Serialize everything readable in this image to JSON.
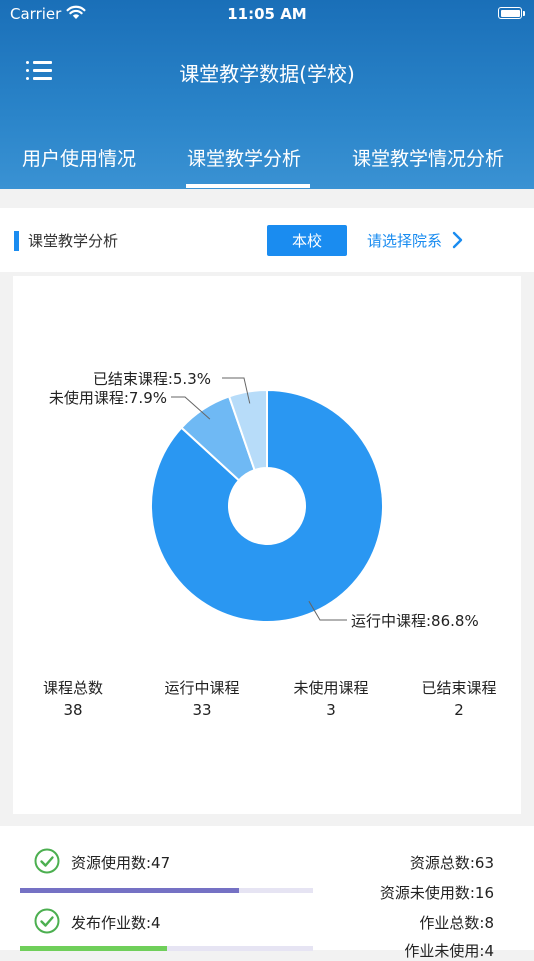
{
  "status": {
    "carrier": "Carrier",
    "time": "11:05 AM"
  },
  "header": {
    "title": "课堂教学数据(学校)"
  },
  "tabs": [
    {
      "label": "用户使用情况"
    },
    {
      "label": "课堂教学分析",
      "active": true
    },
    {
      "label": "课堂教学情况分析"
    }
  ],
  "section": {
    "title": "课堂教学分析",
    "button": "本校",
    "select": "请选择院系"
  },
  "chart_data": {
    "type": "pie",
    "donut": true,
    "slices": [
      {
        "label": "运行中课程:86.8%",
        "value": 86.8,
        "color": "#2a97f2"
      },
      {
        "label": "未使用课程:7.9%",
        "value": 7.9,
        "color": "#6fb9f4"
      },
      {
        "label": "已结束课程:5.3%",
        "value": 5.3,
        "color": "#b7dcf9"
      }
    ]
  },
  "stats": [
    {
      "label": "课程总数",
      "value": "38"
    },
    {
      "label": "运行中课程",
      "value": "33"
    },
    {
      "label": "未使用课程",
      "value": "3"
    },
    {
      "label": "已结束课程",
      "value": "2"
    }
  ],
  "bottom": {
    "resource_used": "资源使用数:47",
    "resource_total": "资源总数:63",
    "resource_unused": "资源未使用数:16",
    "resource_progress": 0.746,
    "homework_published": "发布作业数:4",
    "homework_total": "作业总数:8",
    "homework_unused": "作业未使用:4",
    "homework_progress": 0.5,
    "colors": {
      "resource_bar": "#7571c4",
      "homework_bar": "#6fcf5a",
      "check": "#4caf50"
    }
  }
}
